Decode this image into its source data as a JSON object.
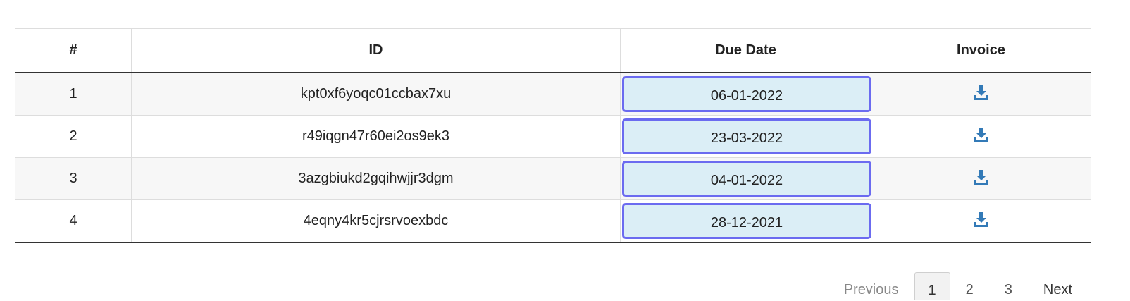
{
  "table": {
    "headers": [
      "#",
      "ID",
      "Due Date",
      "Invoice"
    ],
    "rows": [
      {
        "num": "1",
        "id": "kpt0xf6yoqc01ccbax7xu",
        "due": "06-01-2022"
      },
      {
        "num": "2",
        "id": "r49iqgn47r60ei2os9ek3",
        "due": "23-03-2022"
      },
      {
        "num": "3",
        "id": "3azgbiukd2gqihwjjr3dgm",
        "due": "04-01-2022"
      },
      {
        "num": "4",
        "id": "4eqny4kr5cjrsrvoexbdc",
        "due": "28-12-2021"
      }
    ],
    "invoice_icon": "download-icon"
  },
  "pagination": {
    "previous": "Previous",
    "pages": [
      "1",
      "2",
      "3"
    ],
    "active_page": "1",
    "next": "Next"
  },
  "colors": {
    "accent": "#6b6bf0",
    "due_bg": "#dbeef6",
    "icon": "#337ab7"
  }
}
